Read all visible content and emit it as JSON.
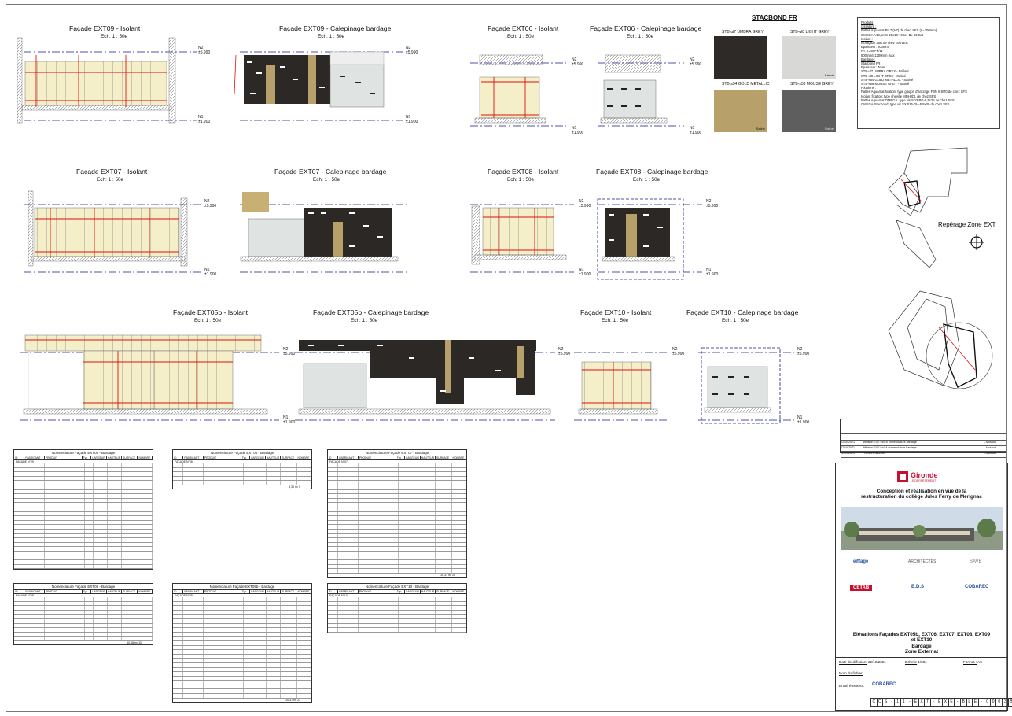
{
  "facades": [
    {
      "title": "Façade EXT09 - Isolant",
      "scale": "Ech: 1 : 50e"
    },
    {
      "title": "Façade EXT09 - Calepinage bardage",
      "scale": "Ech: 1 : 50e"
    },
    {
      "title": "Façade EXT06 - Isolant",
      "scale": "Ech: 1 : 50e"
    },
    {
      "title": "Façade EXT06 - Calepinage bardage",
      "scale": "Ech: 1 : 50e"
    },
    {
      "title": "Façade EXT07 - Isolant",
      "scale": "Ech: 1 : 50e"
    },
    {
      "title": "Façade EXT07 - Calepinage bardage",
      "scale": "Ech: 1 : 50e"
    },
    {
      "title": "Façade EXT08 - Isolant",
      "scale": "Ech: 1 : 50e"
    },
    {
      "title": "Façade EXT08 - Calepinage bardage",
      "scale": "Ech: 1 : 50e"
    },
    {
      "title": "Façade EXT05b - Isolant",
      "scale": "Ech: 1 : 50e"
    },
    {
      "title": "Façade EXT05b - Calepinage bardage",
      "scale": "Ech: 1 : 50e"
    },
    {
      "title": "Façade EXT10 - Isolant",
      "scale": "Ech: 1 : 50e"
    },
    {
      "title": "Façade EXT10 - Calepinage bardage",
      "scale": "Ech: 1 : 50e"
    }
  ],
  "levels": {
    "n2": "N2",
    "n2_val": "±5.990",
    "n1": "N1",
    "n1_val": "±1.900"
  },
  "stacbond": {
    "title": "STACBOND FR",
    "swatches": [
      {
        "label": "STB-ul7 UMBRA GREY",
        "finish": "",
        "color": "#2d2a28"
      },
      {
        "label": "STB-ul8 LIGHT GREY",
        "finish": "Satiné",
        "color": "#d8d8d6"
      },
      {
        "label": "STB-s54 GOLD METALLIC",
        "finish": "Satiné",
        "color": "#b8a06a"
      },
      {
        "label": "STB-s58 MOUSE GREY",
        "finish": "Satiné",
        "color": "#5e5e5e"
      }
    ]
  },
  "notes": {
    "produits": "Produits",
    "ossature": "Ossature :",
    "ossature_l1": "Pattes Aquamat BL 7 (V7) de chez SFS (L=200mm)",
    "ossature_l2": "OMEGA A13,5mm 25x10+ 60x1 BL 60.0x0",
    "isolant": "Isolant :",
    "isolant_l1": "Isofaçade 35R de chez ISOVER",
    "isolant_l2": "Epaisseur: 200mm",
    "isolant_l3": "R= 5.25m²K/W",
    "isolant_l4": "600mm/x1200mm max",
    "bardage": "Bardage :",
    "bardage_l1": "Stacbond FR",
    "bardage_l2": "Epaisseur: 4mm",
    "bardage_l3": "STB-ul7 UMBRA GREY - Brillant",
    "bardage_l4": "STB-ul8 LIGHT GREY - Satiné",
    "bardage_l5": "STB-s54 GOLD METALLIC - Satiné",
    "bardage_l6": "STB-s58 MOUSE GREY - Satiné",
    "fixations": "Fixations :",
    "fixations_l1": "Pattes Aquamat fixation: type goujon d'ancrage FBN II 8/70 de chez SFS",
    "fixations_l2": "Isolant fixation: type cheville MDH-tbt. de chez SFS",
    "fixations_l3": "Pattes Aquamat OMEGA: type vis SD3-PG-5,5x25 de chez SFS",
    "fixations_l4": "OMEGA/Stacbond: type vis SX3/15-DH-5,5x30 de chez SFS"
  },
  "reperage": {
    "label": "Repérage Zone EXT"
  },
  "tables": [
    {
      "title": "Nomenclature Façade EXT09 - Bardage",
      "section": "FAÇADE N°09",
      "total": "",
      "rows": 24
    },
    {
      "title": "Nomenclature Façade EXT06 - Bardage",
      "section": "FAÇADE N°06",
      "total": "5,30 m²    5",
      "rows": 5
    },
    {
      "title": "Nomenclature Façade EXT07 - Bardage",
      "section": "FAÇADE N°07",
      "total": "20,37 m²    26",
      "rows": 25
    },
    {
      "title": "Nomenclature Façade EXT08 - Bardage",
      "section": "FAÇADE N°08",
      "total": "10,68 m²    10",
      "rows": 10
    },
    {
      "title": "Nomenclature Façade EXT05b - Bardage",
      "section": "FAÇADE N°05",
      "total": "20,37 m²    23",
      "rows": 23
    },
    {
      "title": "Nomenclature Façade EXT10 - Bardage",
      "section": "FAÇADE N°10",
      "total": "",
      "rows": 8
    }
  ],
  "table_header": [
    "ID",
    "FABRICANT",
    "PRODUIT",
    "Typ",
    "LARGEUR",
    "HAUTEUR",
    "SURFACE",
    "NOMBRE"
  ],
  "revisions": [
    {
      "date": "22/10/2021",
      "text": "diffusion EXE Ind. B nomenclature bardage",
      "by": "L.Musaud"
    },
    {
      "date": "07/10/2021",
      "text": "diffusion EXE Ind. A nomenclature bardage",
      "by": "L.Musaud"
    },
    {
      "date": "22/09/2021",
      "text": "Première diffusion",
      "by": "L.Musaud"
    }
  ],
  "cartouche": {
    "client": "Gironde",
    "client_sub": "LE DÉPARTEMENT",
    "project_l1": "Conception et réalisation en vue de la",
    "project_l2": "restructuration du collège Jules Ferry de Mérignac",
    "partners": [
      "eiffage",
      "ARCHITECTES",
      "SAVE",
      "CETAB",
      "B.D.S",
      "COBAREC"
    ],
    "sheet_l1": "Elévations Façades EXT05b, EXT06, EXT07, EXT08, EXT09",
    "sheet_l2": "et EXT10",
    "sheet_l3": "Bardage",
    "sheet_l4": "Zone Externat",
    "date_label": "Date de diffusion:",
    "date_val": "22/10/2021",
    "scale_label": "Echelle",
    "scale_val": "1/50e",
    "format_label": "Format :",
    "format_val": "A0",
    "file_label": "Nom du fichier:",
    "emitter_label": "Entité émetteur:",
    "emitter": "COBAREC",
    "code": [
      "C",
      "O",
      "S",
      "-",
      "1",
      "1",
      "-",
      "E",
      "X",
      "T",
      "-",
      "E",
      "X",
      "E",
      "-",
      "B",
      "L",
      "E",
      "-",
      "0",
      "0",
      "0",
      "3",
      "B"
    ]
  }
}
